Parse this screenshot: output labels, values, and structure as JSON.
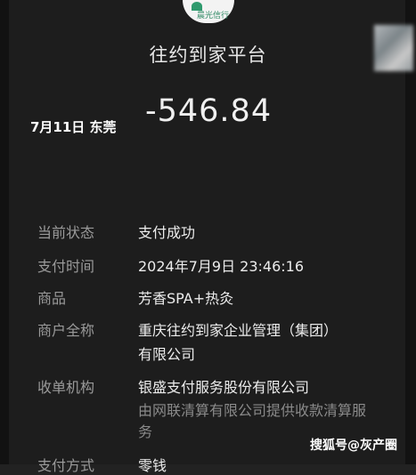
{
  "header": {
    "logo_text": "晨光信行",
    "merchant": "往约到家平台"
  },
  "overlay_caption": "7月11日 东莞",
  "amount": "-546.84",
  "details": [
    {
      "label": "当前状态",
      "value": "支付成功"
    },
    {
      "label": "支付时间",
      "value": "2024年7月9日 23:46:16"
    },
    {
      "label": "商品",
      "value": "芳香SPA+热灸"
    },
    {
      "label": "商户全称",
      "value": "重庆往约到家企业管理（集团）",
      "value2": "有限公司"
    },
    {
      "label": "收单机构",
      "value": "银盛支付服务股份有限公司",
      "note": "由网联清算有限公司提供收款清算服务"
    },
    {
      "label": "支付方式",
      "value": "零钱"
    }
  ],
  "watermark": "搜狐号@灰产圈"
}
